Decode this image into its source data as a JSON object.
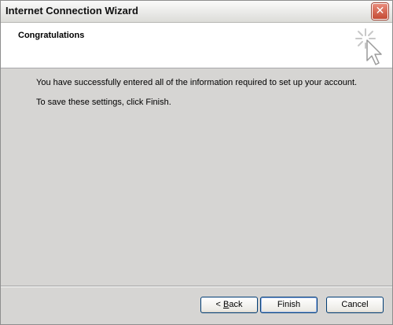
{
  "window": {
    "title": "Internet Connection Wizard",
    "close_glyph": "✕"
  },
  "header": {
    "title": "Congratulations",
    "icon": "sparkle-cursor-icon"
  },
  "content": {
    "message_1": "You have successfully entered all of the information required to set up your account.",
    "message_2": "To save these settings, click Finish."
  },
  "buttons": {
    "back_prefix": "< ",
    "back_accel": "B",
    "back_rest": "ack",
    "finish": "Finish",
    "cancel": "Cancel"
  },
  "colors": {
    "dialog_bg": "#d6d5d3",
    "header_bg": "#ffffff",
    "button_border": "#003c74",
    "close_button": "#c44b35"
  }
}
